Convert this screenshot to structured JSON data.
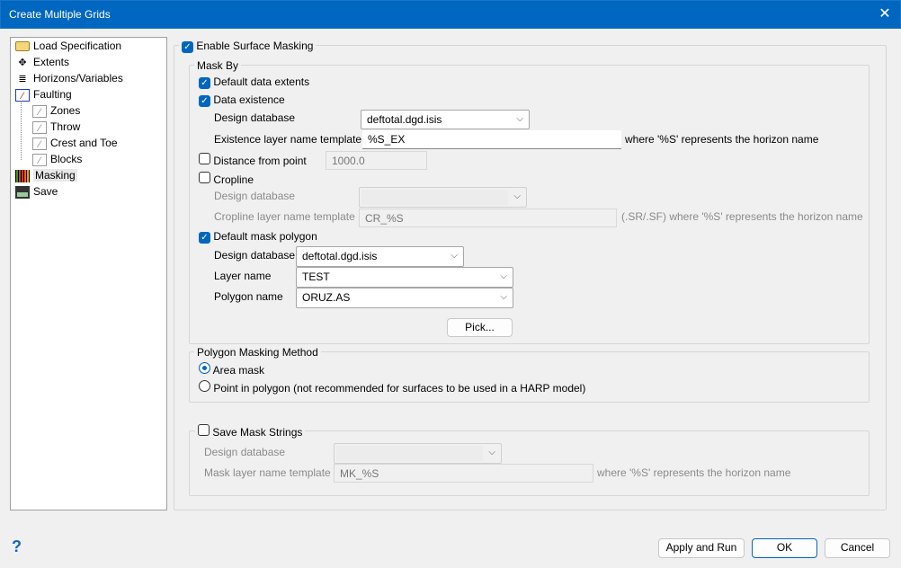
{
  "window": {
    "title": "Create Multiple Grids",
    "close": "✕"
  },
  "tree": [
    {
      "label": "Load Specification",
      "icon": "folder-icon"
    },
    {
      "label": "Extents",
      "icon": "move-arrows-icon"
    },
    {
      "label": "Horizons/Variables",
      "icon": "layers-icon"
    },
    {
      "label": "Faulting",
      "icon": "fault-icon"
    },
    {
      "label": "Zones",
      "icon": "fault-icon"
    },
    {
      "label": "Throw",
      "icon": "fault-icon"
    },
    {
      "label": "Crest and Toe",
      "icon": "fault-icon"
    },
    {
      "label": "Blocks",
      "icon": "fault-icon"
    },
    {
      "label": "Masking",
      "icon": "grid-mask-icon"
    },
    {
      "label": "Save",
      "icon": "save-icon"
    }
  ],
  "enable": {
    "label": "Enable Surface Masking",
    "checked": true
  },
  "mask_by": {
    "title": "Mask By",
    "default_extents": {
      "label": "Default data extents",
      "checked": true
    },
    "data_existence": {
      "label": "Data existence",
      "checked": true,
      "db_label": "Design database",
      "db_value": "deftotal.dgd.isis",
      "tmpl_label": "Existence layer name template",
      "tmpl_value": "%S_EX",
      "note": "where '%S' represents the horizon name"
    },
    "distance": {
      "label": "Distance from point",
      "checked": false,
      "value": "1000.0"
    },
    "cropline": {
      "label": "Cropline",
      "checked": false,
      "db_label": "Design database",
      "db_value": "",
      "tmpl_label": "Cropline layer name template",
      "tmpl_value": "CR_%S",
      "note": "(.SR/.SF) where '%S' represents the horizon name"
    },
    "polygon": {
      "label": "Default mask polygon",
      "checked": true,
      "db_label": "Design database",
      "db_value": "deftotal.dgd.isis",
      "layer_label": "Layer name",
      "layer_value": "TEST",
      "poly_label": "Polygon name",
      "poly_value": "ORUZ.AS",
      "pick": "Pick..."
    }
  },
  "method": {
    "title": "Polygon Masking Method",
    "area": "Area mask",
    "point": "Point in polygon (not recommended for surfaces to be used in a HARP model)",
    "selected": "area"
  },
  "save_strings": {
    "label": "Save Mask Strings",
    "checked": false,
    "db_label": "Design database",
    "db_value": "",
    "tmpl_label": "Mask layer name template",
    "tmpl_value": "MK_%S",
    "note": "where '%S' represents the horizon name"
  },
  "footer": {
    "help": "?",
    "apply": "Apply and Run",
    "ok": "OK",
    "cancel": "Cancel"
  }
}
